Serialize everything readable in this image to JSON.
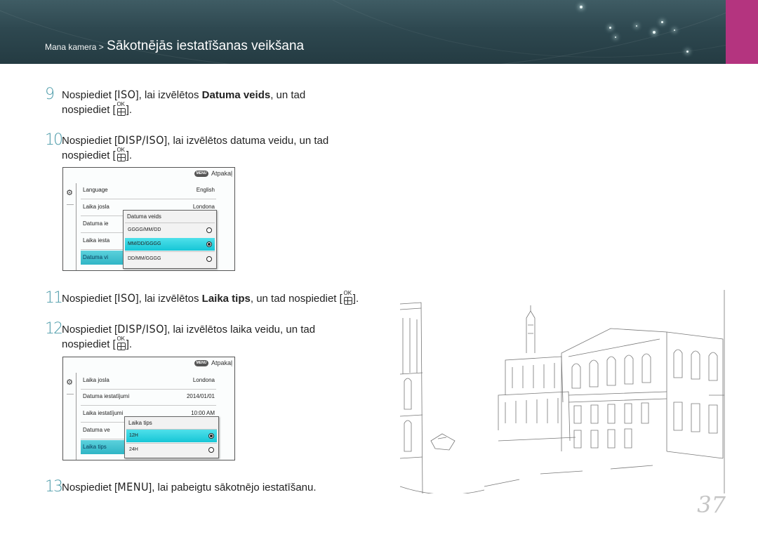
{
  "header": {
    "breadcrumb_small": "Mana kamera >",
    "breadcrumb_title": "Sākotnējās iestatīšanas veikšana",
    "accent": "#b4347f"
  },
  "steps": [
    {
      "num": "9",
      "l1_a": "Nospiediet [",
      "l1_key": "ISO",
      "l1_b": "], lai izvēlētos ",
      "l1_bold": "Datuma veids",
      "l1_c": ", un tad",
      "l2_a": "nospiediet [",
      "l2_ok": "OK",
      "l2_b": "]."
    },
    {
      "num": "10",
      "l1_a": "Nospiediet [",
      "l1_key": "DISP/ISO",
      "l1_b": "], lai izvēlētos datuma veidu, un tad",
      "l2_a": "nospiediet [",
      "l2_ok": "OK",
      "l2_b": "]."
    },
    {
      "num": "11",
      "l1_a": "Nospiediet [",
      "l1_key": "ISO",
      "l1_b": "], lai izvēlētos ",
      "l1_bold": "Laika tips",
      "l1_c": ", un tad nospiediet [",
      "l1_ok": "OK",
      "l1_d": "]."
    },
    {
      "num": "12",
      "l1_a": "Nospiediet [",
      "l1_key": "DISP/ISO",
      "l1_b": "], lai izvēlētos laika veidu, un tad",
      "l2_a": "nospiediet [",
      "l2_ok": "OK",
      "l2_b": "]."
    },
    {
      "num": "13",
      "l1_a": "Nospiediet [",
      "l1_key": "MENU",
      "l1_b": "], lai pabeigtu sākotnējo iestatīšanu."
    }
  ],
  "screen1": {
    "menu_label": "MENU",
    "back_label": "Atpakaļ",
    "rows": [
      {
        "label": "Language",
        "value": "English"
      },
      {
        "label": "Laika josla",
        "value": "Londona"
      },
      {
        "label": "Datuma ie",
        "value": ""
      },
      {
        "label": "Laika iesta",
        "value": ""
      },
      {
        "label": "Datuma vi",
        "value": ""
      }
    ],
    "popup": {
      "title": "Datuma veids",
      "options": [
        "GGGG/MM/DD",
        "MM/DD/GGGG",
        "DD/MM/GGGG"
      ],
      "selected": "MM/DD/GGGG"
    }
  },
  "screen2": {
    "menu_label": "MENU",
    "back_label": "Atpakaļ",
    "rows": [
      {
        "label": "Laika josla",
        "value": "Londona"
      },
      {
        "label": "Datuma iestatījumi",
        "value": "2014/01/01"
      },
      {
        "label": "Laika iestatījumi",
        "value": "10:00 AM"
      },
      {
        "label": "Datuma ve",
        "value": ""
      },
      {
        "label": "Laika tips",
        "value": ""
      }
    ],
    "popup": {
      "title": "Laika tips",
      "options": [
        "12H",
        "24H"
      ],
      "selected": "12H"
    }
  },
  "page_number": "37",
  "illustration_icon": "venice-canal-line-drawing"
}
